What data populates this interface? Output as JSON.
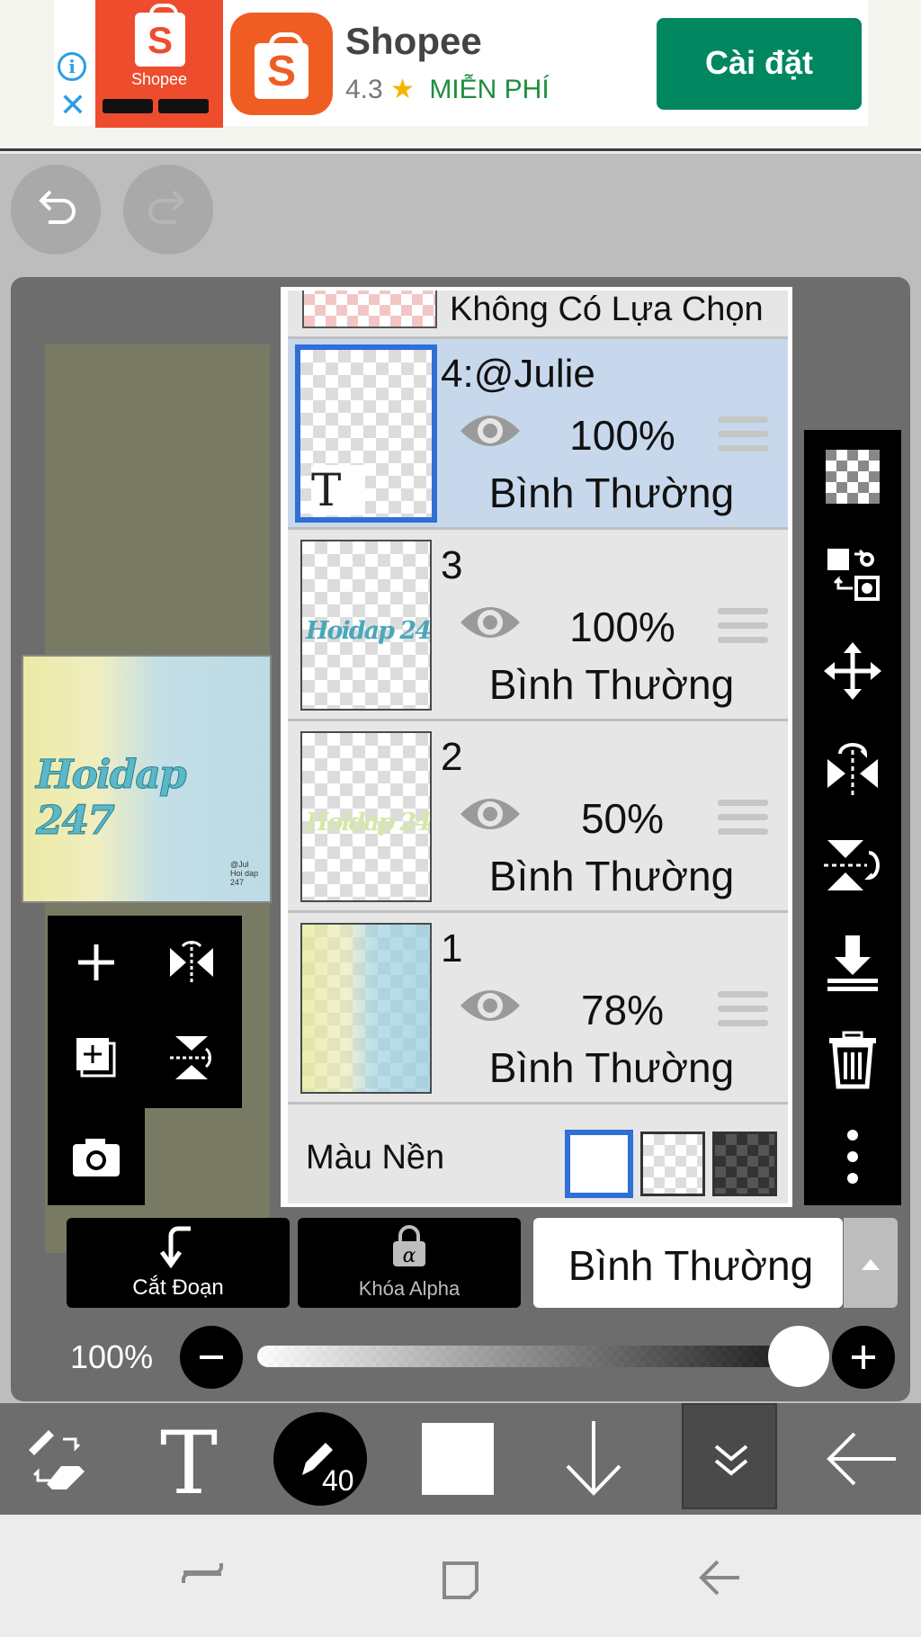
{
  "ad": {
    "image_brand": "Shopee",
    "app_name": "Shopee",
    "rating": "4.3",
    "star": "★",
    "price": "MIỄN PHÍ",
    "install_label": "Cài đặt",
    "brand_color": "#ee4d2d",
    "install_color": "#01875f"
  },
  "canvas": {
    "preview_text": "Hoidap 247",
    "preview_credit": "@Jul\nHoi dap\n247"
  },
  "layers": {
    "selection_label": "Không Có Lựa Chọn",
    "items": [
      {
        "name": "4:@Julie",
        "opacity": "100%",
        "blend": "Bình Thường",
        "active": true,
        "thumb_glyph": "T"
      },
      {
        "name": "3",
        "opacity": "100%",
        "blend": "Bình Thường",
        "thumb_text": "Hoidap 24"
      },
      {
        "name": "2",
        "opacity": "50%",
        "blend": "Bình Thường",
        "thumb_text": "Hoidap 24"
      },
      {
        "name": "1",
        "opacity": "78%",
        "blend": "Bình Thường"
      }
    ],
    "background_label": "Màu Nền"
  },
  "controls": {
    "clip_label": "Cắt Đoạn",
    "alpha_lock_label": "Khóa Alpha",
    "blend_mode": "Bình Thường",
    "opacity": "100%",
    "brush_size": "40",
    "accent_color": "#2f6fd6"
  }
}
